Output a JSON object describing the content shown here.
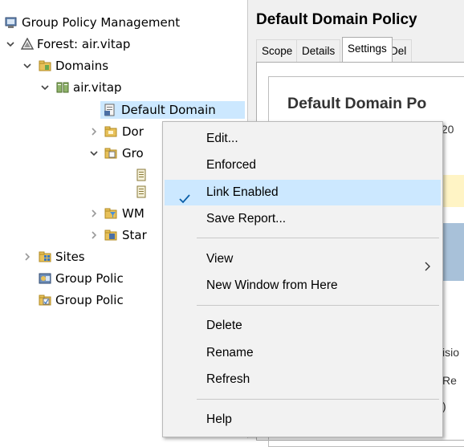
{
  "tree": {
    "root": {
      "label": "Group Policy Management",
      "icon": "group-policy-management-icon"
    },
    "forest": {
      "label": "Forest: air.vitap",
      "icon": "forest-icon"
    },
    "domains": {
      "label": "Domains",
      "icon": "domains-folder-icon"
    },
    "domain": {
      "label": "air.vitap",
      "icon": "domain-icon"
    },
    "default_domain_link": {
      "label": "Default Domain",
      "icon": "gpo-link-icon"
    },
    "domain_controllers": {
      "label": "Dor",
      "icon": "ou-folder-icon"
    },
    "gpo_container": {
      "label": "Gro",
      "icon": "gpo-container-icon"
    },
    "wmi": {
      "label": "WM",
      "icon": "wmi-filter-icon"
    },
    "starter": {
      "label": "Star",
      "icon": "starter-gpo-icon"
    },
    "sites": {
      "label": "Sites",
      "icon": "sites-icon"
    },
    "modeling": {
      "label": "Group Polic",
      "icon": "modeling-icon"
    },
    "results": {
      "label": "Group Polic",
      "icon": "results-icon"
    }
  },
  "details": {
    "title": "Default Domain Policy",
    "tabs": [
      "Scope",
      "Details",
      "Settings",
      "Del"
    ],
    "active_tab": "Settings",
    "report_title": "Default Domain Po",
    "report_date": "/20",
    "fragments": [
      "isio",
      "Re",
      ")"
    ]
  },
  "context_menu": {
    "items": [
      {
        "label": "Edit..."
      },
      {
        "label": "Enforced"
      },
      {
        "label": "Link Enabled",
        "checked": true
      },
      {
        "label": "Save Report..."
      },
      {
        "label": "View",
        "submenu": true
      },
      {
        "label": "New Window from Here"
      },
      {
        "label": "Delete"
      },
      {
        "label": "Rename"
      },
      {
        "label": "Refresh"
      },
      {
        "label": "Help"
      }
    ]
  },
  "colors": {
    "highlight": "#cce8ff",
    "menu_bg": "#f2f2f2",
    "check": "#0a5ea8"
  }
}
